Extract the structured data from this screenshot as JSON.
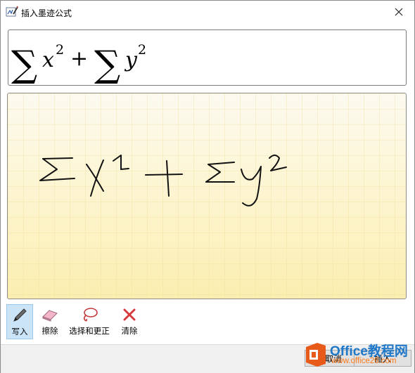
{
  "window": {
    "title": "插入墨迹公式",
    "close_icon": "close-icon",
    "app_icon": "ink-equation-icon"
  },
  "preview": {
    "formula_parts": [
      "∑",
      "x",
      "2",
      "+",
      "∑",
      "y",
      "2"
    ]
  },
  "toolbar": {
    "tools": [
      {
        "label": "写入",
        "icon": "pen-icon",
        "active": true
      },
      {
        "label": "擦除",
        "icon": "eraser-icon",
        "active": false
      },
      {
        "label": "选择和更正",
        "icon": "lasso-icon",
        "active": false
      },
      {
        "label": "清除",
        "icon": "clear-icon",
        "active": false
      }
    ]
  },
  "footer": {
    "cancel_label": "取消",
    "insert_label": "插入"
  },
  "watermark": {
    "line1": "Office教程网",
    "line2": "www.office26.com"
  },
  "colors": {
    "pad_top": "#fcfaf0",
    "pad_bottom": "#fbeeb0",
    "grid": "#f3e3a0",
    "ink": "#111111",
    "active_tool": "#cce4f7"
  }
}
